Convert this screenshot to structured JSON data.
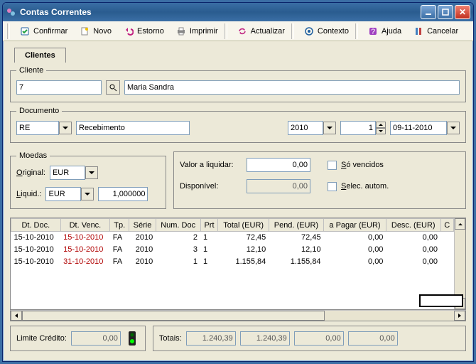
{
  "window": {
    "title": "Contas Correntes"
  },
  "toolbar": {
    "confirmar": "Confirmar",
    "novo": "Novo",
    "estorno": "Estorno",
    "imprimir": "Imprimir",
    "actualizar": "Actualizar",
    "contexto": "Contexto",
    "ajuda": "Ajuda",
    "cancelar": "Cancelar"
  },
  "tabs": {
    "clientes": "Clientes"
  },
  "cliente": {
    "legend": "Cliente",
    "number": "7",
    "name": "Maria Sandra"
  },
  "documento": {
    "legend": "Documento",
    "type": "RE",
    "type_desc": "Recebimento",
    "year": "2010",
    "seq": "1",
    "date": "09-11-2010"
  },
  "moedas": {
    "legend": "Moedas",
    "original_lbl": "Original:",
    "original": "EUR",
    "liquid_lbl": "Liquid.:",
    "liquid": "EUR",
    "rate": "1,000000"
  },
  "liquidar": {
    "valor_lbl": "Valor a liquidar:",
    "valor": "0,00",
    "so_vencidos_lbl": "Só vencidos",
    "disponivel_lbl": "Disponível:",
    "disponivel": "0,00",
    "selec_autom_lbl": "Selec. autom."
  },
  "table": {
    "headers": {
      "dt_doc": "Dt. Doc.",
      "dt_venc": "Dt. Venc.",
      "tp": "Tp.",
      "serie": "Série",
      "num_doc": "Num. Doc",
      "prt": "Prt",
      "total": "Total (EUR)",
      "pend": "Pend. (EUR)",
      "a_pagar": "a Pagar (EUR)",
      "desc": "Desc. (EUR)",
      "c": "C"
    },
    "rows": [
      {
        "dt_doc": "15-10-2010",
        "dt_venc": "15-10-2010",
        "venc_past": true,
        "tp": "FA",
        "serie": "2010",
        "num_doc": "2",
        "prt": "1",
        "total": "72,45",
        "pend": "72,45",
        "a_pagar": "0,00",
        "desc": "0,00"
      },
      {
        "dt_doc": "15-10-2010",
        "dt_venc": "15-10-2010",
        "venc_past": true,
        "tp": "FA",
        "serie": "2010",
        "num_doc": "3",
        "prt": "1",
        "total": "12,10",
        "pend": "12,10",
        "a_pagar": "0,00",
        "desc": "0,00"
      },
      {
        "dt_doc": "15-10-2010",
        "dt_venc": "31-10-2010",
        "venc_past": true,
        "tp": "FA",
        "serie": "2010",
        "num_doc": "1",
        "prt": "1",
        "total": "1.155,84",
        "pend": "1.155,84",
        "a_pagar": "0,00",
        "desc": "0,00"
      }
    ]
  },
  "footer": {
    "limite_lbl": "Limite Crédito:",
    "limite": "0,00",
    "totais_lbl": "Totais:",
    "t1": "1.240,39",
    "t2": "1.240,39",
    "t3": "0,00",
    "t4": "0,00"
  }
}
